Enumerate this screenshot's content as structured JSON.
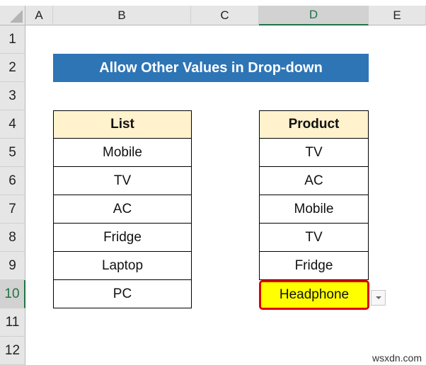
{
  "columns": [
    "A",
    "B",
    "C",
    "D",
    "E"
  ],
  "selected_column": "D",
  "rows": [
    "1",
    "2",
    "3",
    "4",
    "5",
    "6",
    "7",
    "8",
    "9",
    "10",
    "11",
    "12"
  ],
  "selected_row": "10",
  "title": "Allow Other Values in Drop-down",
  "list_table": {
    "header": "List",
    "items": [
      "Mobile",
      "TV",
      "AC",
      "Fridge",
      "Laptop",
      "PC"
    ]
  },
  "product_table": {
    "header": "Product",
    "items": [
      "TV",
      "AC",
      "Mobile",
      "TV",
      "Fridge"
    ],
    "active_value": "Headphone"
  },
  "colors": {
    "title_bg": "#2e75b6",
    "header_bg": "#fff2cc",
    "active_fill": "#ffff00",
    "active_border": "#e00000",
    "excel_green": "#217346"
  },
  "watermark": "wsxdn.com"
}
